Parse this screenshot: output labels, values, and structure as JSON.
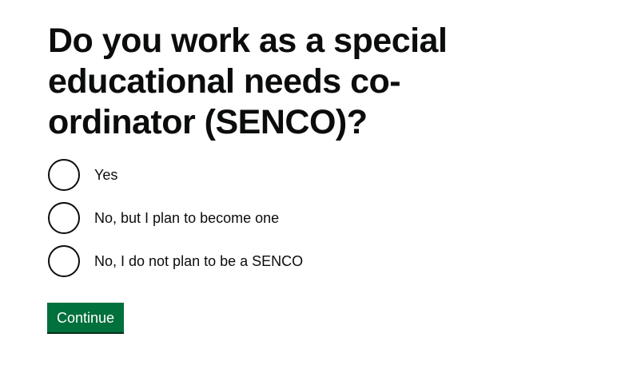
{
  "question": {
    "title": "Do you work as a special educational needs co-ordinator (SENCO)?"
  },
  "options": [
    {
      "label": "Yes"
    },
    {
      "label": "No, but I plan to become one"
    },
    {
      "label": "No, I do not plan to be a SENCO"
    }
  ],
  "actions": {
    "continue_label": "Continue"
  },
  "colors": {
    "text": "#0b0c0c",
    "button_background": "#00703c",
    "button_text": "#ffffff"
  }
}
